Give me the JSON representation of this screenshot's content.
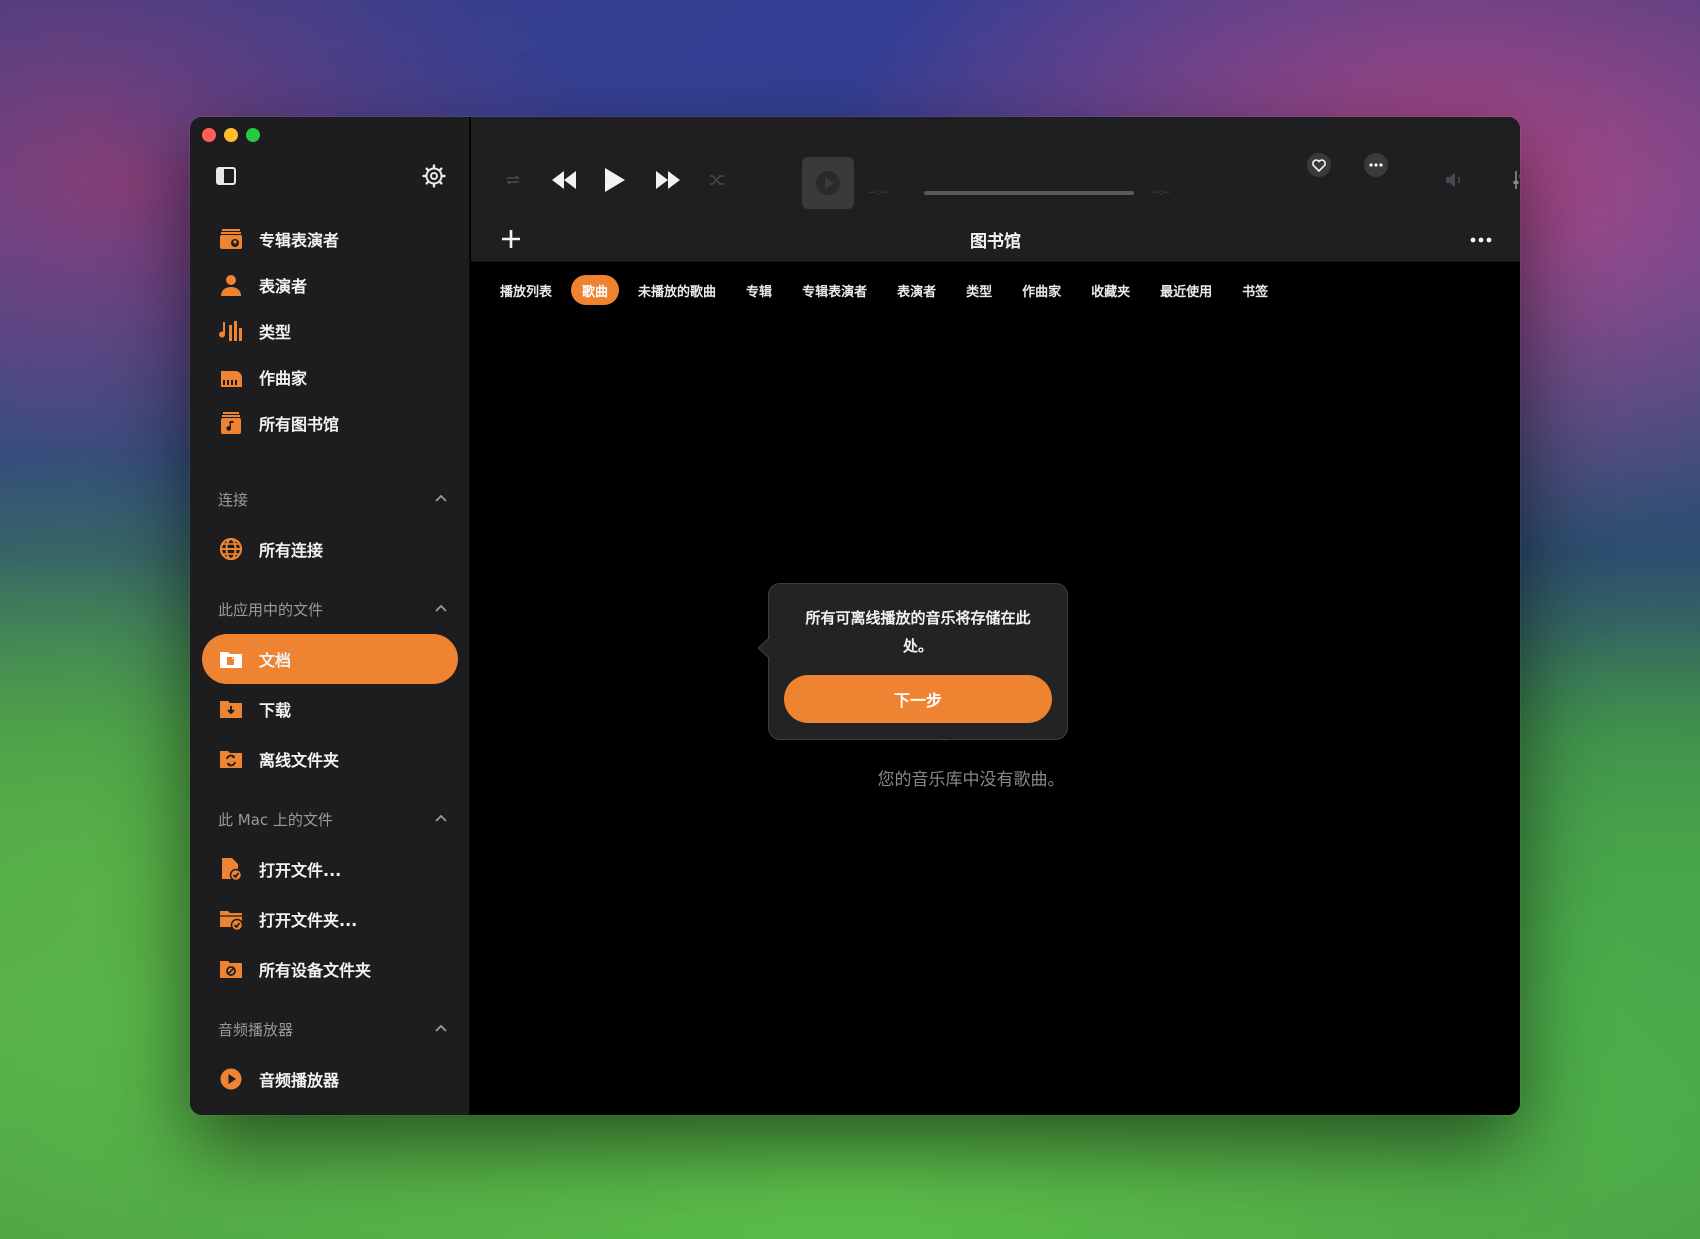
{
  "sidebar": {
    "library_items": [
      {
        "label": "专辑表演者",
        "icon": "album-artists-icon"
      },
      {
        "label": "表演者",
        "icon": "artist-icon"
      },
      {
        "label": "类型",
        "icon": "genre-icon"
      },
      {
        "label": "作曲家",
        "icon": "composer-icon"
      },
      {
        "label": "所有图书馆",
        "icon": "all-libraries-icon"
      }
    ],
    "sections": [
      {
        "title": "连接",
        "items": [
          {
            "label": "所有连接",
            "icon": "globe-icon"
          }
        ]
      },
      {
        "title": "此应用中的文件",
        "items": [
          {
            "label": "文档",
            "icon": "documents-folder-icon",
            "active": true
          },
          {
            "label": "下载",
            "icon": "downloads-folder-icon"
          },
          {
            "label": "离线文件夹",
            "icon": "offline-folder-icon"
          }
        ]
      },
      {
        "title": "此 Mac 上的文件",
        "items": [
          {
            "label": "打开文件...",
            "icon": "open-file-icon"
          },
          {
            "label": "打开文件夹...",
            "icon": "open-folder-icon"
          },
          {
            "label": "所有设备文件夹",
            "icon": "device-folders-icon"
          }
        ]
      },
      {
        "title": "音频播放器",
        "items": [
          {
            "label": "音频播放器",
            "icon": "audio-player-icon"
          }
        ]
      }
    ]
  },
  "player": {
    "elapsed": "--:--",
    "remaining": "--:--",
    "progress": 0
  },
  "header": {
    "title": "图书馆"
  },
  "tabs": [
    "播放列表",
    "歌曲",
    "未播放的歌曲",
    "专辑",
    "专辑表演者",
    "表演者",
    "类型",
    "作曲家",
    "收藏夹",
    "最近使用",
    "书签"
  ],
  "active_tab": "歌曲",
  "empty_state": {
    "message": "您的音乐库中没有歌曲。"
  },
  "popover": {
    "message": "所有可离线播放的音乐将存储在此处。",
    "button": "下一步"
  },
  "colors": {
    "accent": "#ee8431",
    "sidebar_bg": "#1d1d1f",
    "content_bg": "#000000"
  }
}
